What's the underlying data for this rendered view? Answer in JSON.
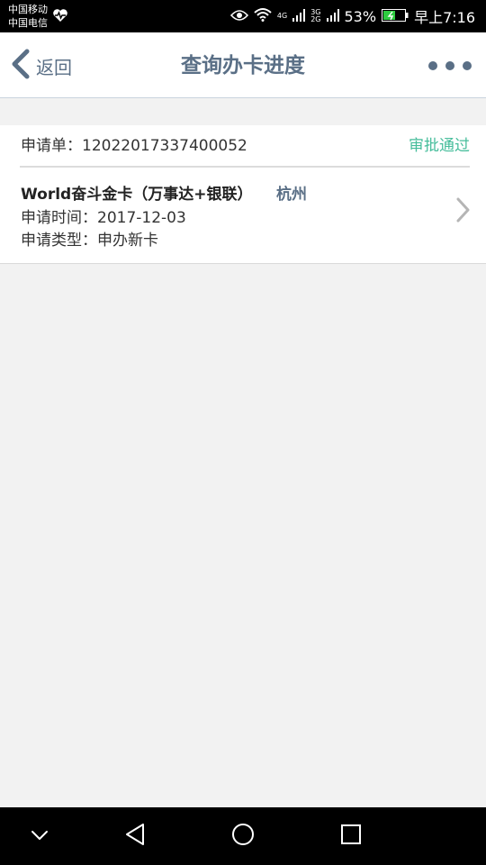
{
  "statusbar": {
    "carrier1": "中国移动",
    "carrier2": "中国电信",
    "net1": "4G",
    "net2_top": "3G",
    "net2_bottom": "2G",
    "battery": "53%",
    "time": "早上7:16",
    "battery_color": "#2ecc40"
  },
  "header": {
    "back_label": "返回",
    "title": "查询办卡进度",
    "accent": "#5a6f86"
  },
  "application": {
    "number_label": "申请单：12022017337400052",
    "status": "审批通过",
    "status_color": "#46bd9b",
    "card_name": "World奋斗金卡（万事达+银联）",
    "city": "杭州",
    "apply_time": "申请时间：2017-12-03",
    "apply_type": "申请类型：申办新卡"
  },
  "icons": {
    "back": "chevron-left-icon",
    "more": "more-icon",
    "detail": "chevron-right-icon"
  }
}
